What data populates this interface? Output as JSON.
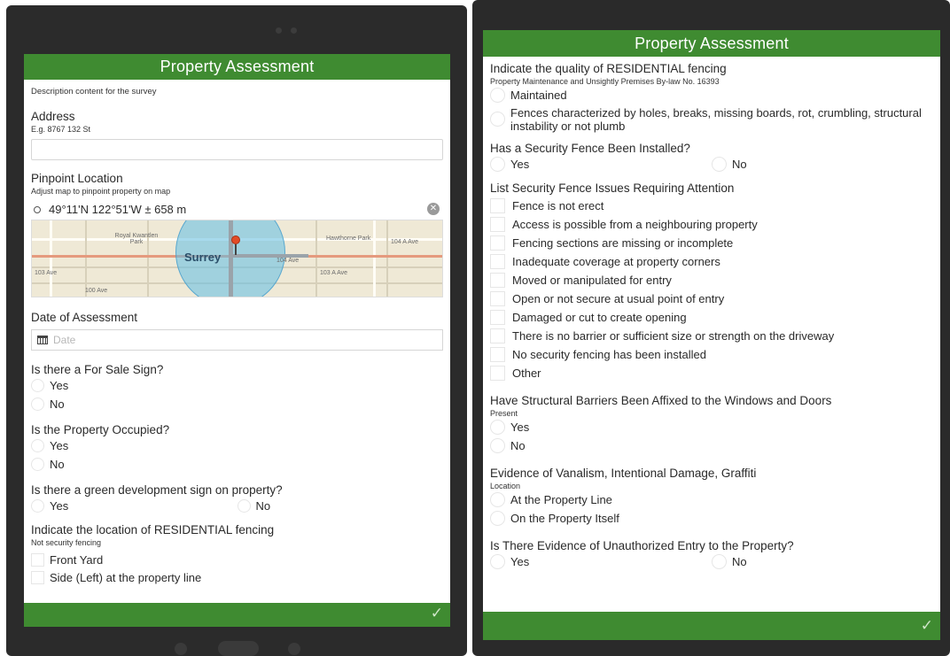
{
  "left": {
    "title": "Property Assessment",
    "description": "Description content for the survey",
    "address": {
      "label": "Address",
      "hint": "E.g. 8767 132 St",
      "value": ""
    },
    "pinpoint": {
      "label": "Pinpoint Location",
      "hint": "Adjust map to pinpoint property on map",
      "coordinates": "49°11'N 122°51'W ± 658 m",
      "map_labels": {
        "city": "Surrey",
        "park1": "Royal Kwantlen Park",
        "park2": "Hawthorne Park",
        "ave104": "104 Ave",
        "ave103": "103 Ave",
        "ave103a": "103 A Ave",
        "ave104a": "104 A Ave",
        "ave100": "100 Ave"
      }
    },
    "date": {
      "label": "Date of Assessment",
      "placeholder": "Date"
    },
    "for_sale": {
      "label": "Is there a For Sale Sign?",
      "options": [
        "Yes",
        "No"
      ]
    },
    "occupied": {
      "label": "Is the Property Occupied?",
      "options": [
        "Yes",
        "No"
      ]
    },
    "green_sign": {
      "label": "Is there a green development sign on property?",
      "options": [
        "Yes",
        "No"
      ]
    },
    "fencing_location": {
      "label": "Indicate the location of RESIDENTIAL fencing",
      "hint": "Not security fencing",
      "options": [
        "Front Yard",
        "Side (Left) at the property line"
      ]
    },
    "submit_icon": "checkmark-icon"
  },
  "right": {
    "title": "Property Assessment",
    "fencing_quality": {
      "label": "Indicate the quality of RESIDENTIAL fencing",
      "hint": "Property Maintenance and Unsightly Premises By-law No. 16393",
      "options": [
        "Maintained",
        "Fences characterized by holes, breaks, missing boards, rot, crumbling, structural instability or not plumb"
      ]
    },
    "security_fence": {
      "label": "Has a Security Fence Been Installed?",
      "options": [
        "Yes",
        "No"
      ]
    },
    "fence_issues": {
      "label": "List Security Fence Issues Requiring Attention",
      "options": [
        "Fence is not erect",
        "Access is possible from a neighbouring property",
        "Fencing sections are missing or incomplete",
        "Inadequate coverage at property corners",
        "Moved or manipulated for entry",
        "Open or not secure at usual point of entry",
        "Damaged or cut to create opening",
        "There is no barrier or sufficient size or strength on the driveway",
        "No security fencing has been installed",
        "Other"
      ]
    },
    "barriers": {
      "label": "Have Structural Barriers Been Affixed to the Windows and Doors",
      "hint": "Present",
      "options": [
        "Yes",
        "No"
      ]
    },
    "vandalism": {
      "label": "Evidence of Vanalism, Intentional Damage, Graffiti",
      "hint": "Location",
      "options": [
        "At the Property Line",
        "On the Property Itself"
      ]
    },
    "unauthorized": {
      "label": "Is There Evidence of Unauthorized Entry to the Property?",
      "options": [
        "Yes",
        "No"
      ]
    },
    "submit_icon": "checkmark-icon"
  },
  "colors": {
    "header_green": "#3f8b31",
    "device_frame": "#2b2b2b"
  }
}
